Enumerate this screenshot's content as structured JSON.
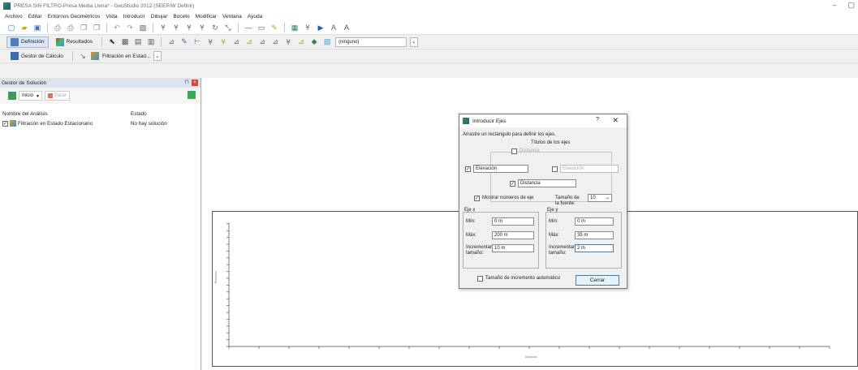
{
  "window": {
    "title": "PRESA SIN FILTRO-Presa Media Llena* - GeoStudio 2012 (SEEP/W Definir)",
    "minimize": "–",
    "restore": "▢"
  },
  "menu": [
    "Archivo",
    "Editar",
    "Entornos Geométricos",
    "Vista",
    "Introducir",
    "Dibujar",
    "Boceto",
    "Modificar",
    "Ventana",
    "Ayuda"
  ],
  "toolbar2": {
    "definicion": "Definición",
    "resultados": "Resultados",
    "combo_value": "(ninguno)"
  },
  "toolbar3": {
    "gestor": "Gestor de Cálculo",
    "analisis": "Filtración en Estad..."
  },
  "sidebar": {
    "title": "Gestor de Solución",
    "start_label": "Inicio",
    "stop_label": "Parar",
    "col_name": "Nombre del Análisis",
    "col_state": "Estado",
    "rows": [
      {
        "name": "Filtración en Estado Estacionario",
        "state": "No hay solución"
      }
    ]
  },
  "plot": {
    "ylabel": "Elevación",
    "xlabel": "Distancia"
  },
  "dialog": {
    "title": "Introducir Ejes",
    "help": "?",
    "close_x": "✕",
    "instruction": "Arrastre un rectángulo para definir los ejes.",
    "titles_header": "Títulos de los ejes",
    "top_title": "Distancia",
    "left_title": "Elevación",
    "right_title": "Elevación",
    "bottom_title": "Distancia",
    "show_numbers": "Mostrar números de eje",
    "font_size_label": "Tamaño de la fuente:",
    "font_size_value": "10",
    "x_axis": {
      "header": "Eje x",
      "min_label": "Mín:",
      "min": "0 m",
      "max_label": "Máx:",
      "max": "200 m",
      "inc_label": "Incrementar tamaño:",
      "inc": "10 m"
    },
    "y_axis": {
      "header": "Eje y",
      "min_label": "Mín:",
      "min": "0 m",
      "max_label": "Máx:",
      "max": "35 m",
      "inc_label": "Incrementar tamaño:",
      "inc": "2 m"
    },
    "auto_inc": "Tamaño de incremento automático",
    "close_button": "Cerrar"
  }
}
